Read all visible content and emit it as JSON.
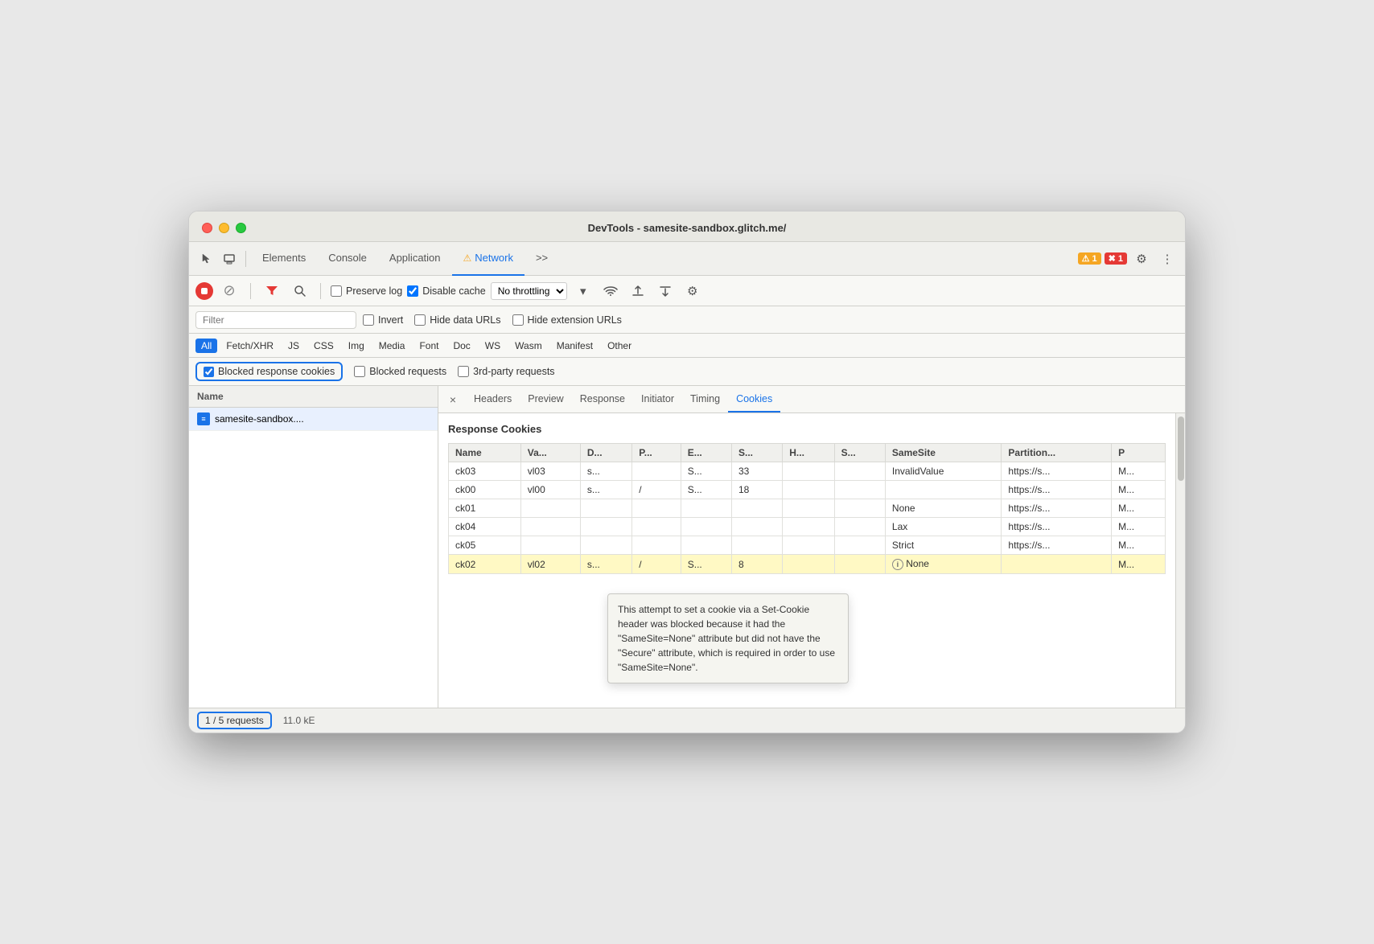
{
  "window": {
    "title": "DevTools - samesite-sandbox.glitch.me/"
  },
  "tabs": {
    "items": [
      {
        "label": "Elements",
        "active": false,
        "warn": false
      },
      {
        "label": "Console",
        "active": false,
        "warn": false
      },
      {
        "label": "Application",
        "active": false,
        "warn": false
      },
      {
        "label": "Network",
        "active": true,
        "warn": true
      },
      {
        "label": ">>",
        "active": false,
        "warn": false
      }
    ]
  },
  "toolbar": {
    "preserve_log_label": "Preserve log",
    "disable_cache_label": "Disable cache",
    "throttle_label": "No throttling",
    "warn_count": "1",
    "error_count": "1"
  },
  "filter": {
    "placeholder": "Filter",
    "invert_label": "Invert",
    "hide_data_urls_label": "Hide data URLs",
    "hide_ext_label": "Hide extension URLs"
  },
  "type_filters": [
    {
      "label": "All",
      "active": true
    },
    {
      "label": "Fetch/XHR",
      "active": false
    },
    {
      "label": "JS",
      "active": false
    },
    {
      "label": "CSS",
      "active": false
    },
    {
      "label": "Img",
      "active": false
    },
    {
      "label": "Media",
      "active": false
    },
    {
      "label": "Font",
      "active": false
    },
    {
      "label": "Doc",
      "active": false
    },
    {
      "label": "WS",
      "active": false
    },
    {
      "label": "Wasm",
      "active": false
    },
    {
      "label": "Manifest",
      "active": false
    },
    {
      "label": "Other",
      "active": false
    }
  ],
  "blocked_filters": [
    {
      "label": "Blocked response cookies",
      "checked": true,
      "highlighted": true
    },
    {
      "label": "Blocked requests",
      "checked": false,
      "highlighted": false
    },
    {
      "label": "3rd-party requests",
      "checked": false,
      "highlighted": false
    }
  ],
  "request_list": {
    "header": "Name",
    "items": [
      {
        "label": "samesite-sandbox....",
        "icon": "doc-icon",
        "selected": true
      }
    ]
  },
  "detail_tabs": [
    {
      "label": "×",
      "is_close": true
    },
    {
      "label": "Headers",
      "active": false
    },
    {
      "label": "Preview",
      "active": false
    },
    {
      "label": "Response",
      "active": false
    },
    {
      "label": "Initiator",
      "active": false
    },
    {
      "label": "Timing",
      "active": false
    },
    {
      "label": "Cookies",
      "active": true
    }
  ],
  "cookies": {
    "section_title": "Response Cookies",
    "columns": [
      "Name",
      "Va...",
      "D...",
      "P...",
      "E...",
      "S...",
      "H...",
      "S...",
      "SameSite",
      "Partition...",
      "P"
    ],
    "rows": [
      {
        "name": "ck03",
        "value": "vl03",
        "domain": "s...",
        "path": "",
        "expires": "S...",
        "size": "33",
        "httponly": "",
        "secure": "",
        "samesite": "InvalidValue",
        "partition": "https://s...",
        "priority": "M...",
        "highlighted": false
      },
      {
        "name": "ck00",
        "value": "vl00",
        "domain": "s...",
        "path": "/",
        "expires": "S...",
        "size": "18",
        "httponly": "",
        "secure": "",
        "samesite": "",
        "partition": "https://s...",
        "priority": "M...",
        "highlighted": false
      },
      {
        "name": "ck01",
        "value": "",
        "domain": "",
        "path": "",
        "expires": "",
        "size": "",
        "httponly": "",
        "secure": "",
        "samesite": "None",
        "partition": "https://s...",
        "priority": "M...",
        "highlighted": false
      },
      {
        "name": "ck04",
        "value": "",
        "domain": "",
        "path": "",
        "expires": "",
        "size": "",
        "httponly": "",
        "secure": "",
        "samesite": "Lax",
        "partition": "https://s...",
        "priority": "M...",
        "highlighted": false
      },
      {
        "name": "ck05",
        "value": "",
        "domain": "",
        "path": "",
        "expires": "",
        "size": "",
        "httponly": "",
        "secure": "",
        "samesite": "Strict",
        "partition": "https://s...",
        "priority": "M...",
        "highlighted": false
      },
      {
        "name": "ck02",
        "value": "vl02",
        "domain": "s...",
        "path": "/",
        "expires": "S...",
        "size": "8",
        "httponly": "",
        "secure": "",
        "samesite": "None",
        "partition": "",
        "priority": "M...",
        "highlighted": true
      }
    ]
  },
  "tooltip": {
    "text": "This attempt to set a cookie via a Set-Cookie header was blocked because it had the \"SameSite=None\" attribute but did not have the \"Secure\" attribute, which is required in order to use \"SameSite=None\"."
  },
  "status_bar": {
    "requests": "1 / 5 requests",
    "size": "11.0 kE"
  }
}
